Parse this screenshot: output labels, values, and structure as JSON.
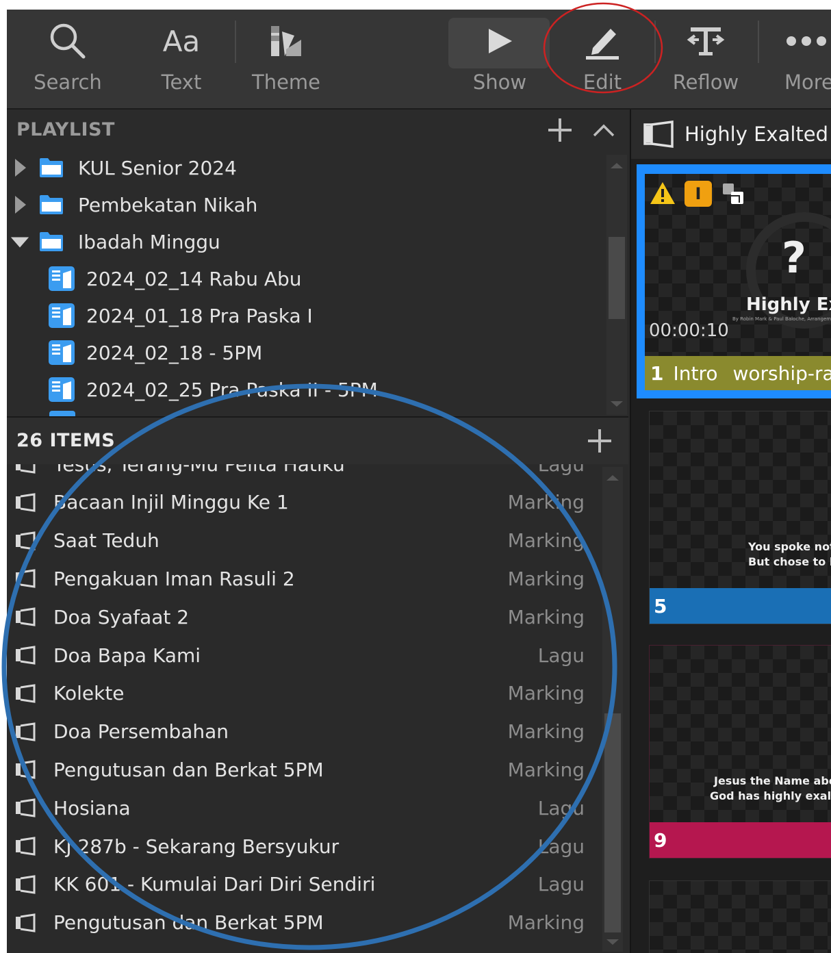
{
  "toolbar": {
    "search": "Search",
    "text": "Text",
    "text_icon": "Aa",
    "theme": "Theme",
    "show": "Show",
    "edit": "Edit",
    "reflow": "Reflow",
    "more": "More"
  },
  "playlist": {
    "title": "PLAYLIST",
    "items": [
      {
        "label": "KUL Senior 2024",
        "kind": "folder",
        "expanded": false
      },
      {
        "label": "Pembekatan Nikah",
        "kind": "folder",
        "expanded": false
      },
      {
        "label": "Ibadah Minggu",
        "kind": "folder",
        "expanded": true
      },
      {
        "label": "2024_02_14 Rabu Abu",
        "kind": "playlist"
      },
      {
        "label": "2024_01_18 Pra Paska I",
        "kind": "playlist"
      },
      {
        "label": "2024_02_18 - 5PM",
        "kind": "playlist"
      },
      {
        "label": "2024_02_25 Pra Paska II - 5PM",
        "kind": "playlist"
      }
    ]
  },
  "items_section": {
    "title": "26 ITEMS",
    "rows": [
      {
        "title": "Yesus, Terang-Mu Pelita Hatiku",
        "type": "Lagu"
      },
      {
        "title": "Bacaan Injil Minggu Ke 1",
        "type": "Marking"
      },
      {
        "title": "Saat Teduh",
        "type": "Marking"
      },
      {
        "title": "Pengakuan Iman Rasuli 2",
        "type": "Marking"
      },
      {
        "title": "Doa Syafaat 2",
        "type": "Marking"
      },
      {
        "title": "Doa Bapa Kami",
        "type": "Lagu"
      },
      {
        "title": "Kolekte",
        "type": "Marking"
      },
      {
        "title": "Doa Persembahan",
        "type": "Marking"
      },
      {
        "title": "Pengutusan dan Berkat 5PM",
        "type": "Marking"
      },
      {
        "title": "Hosiana",
        "type": "Lagu"
      },
      {
        "title": "KJ 287b - Sekarang Bersyukur",
        "type": "Lagu"
      },
      {
        "title": "KK 601 - Kumulai Dari Diri Sendiri",
        "type": "Lagu"
      },
      {
        "title": "Pengutusan dan Berkat 5PM",
        "type": "Marking"
      }
    ]
  },
  "right_pane": {
    "title": "Highly Exalted",
    "slides": [
      {
        "number": "1",
        "label": "Intro",
        "group": "worship-ra",
        "timecode": "00:00:10",
        "overlay_title": "Highly Exal",
        "overlay_credit": "By Robin Mark & Paul Baloche, Arrangement: D",
        "warning_badge": "!",
        "info_badge": "I",
        "question_mark": "?",
        "footer_color": "#8a8a2e",
        "selected": true
      },
      {
        "number": "5",
        "line1": "You spoke not a",
        "line2": "But chose to be",
        "footer_color": "#1a6fb5"
      },
      {
        "number": "9",
        "line1": "Jesus the Name abov",
        "line2": "God has highly exalted",
        "footer_color": "#b5174f"
      }
    ]
  },
  "colors": {
    "selection_border": "#1e8cff",
    "annotation_red": "#cc2222",
    "annotation_blue": "#2e6fb0"
  }
}
